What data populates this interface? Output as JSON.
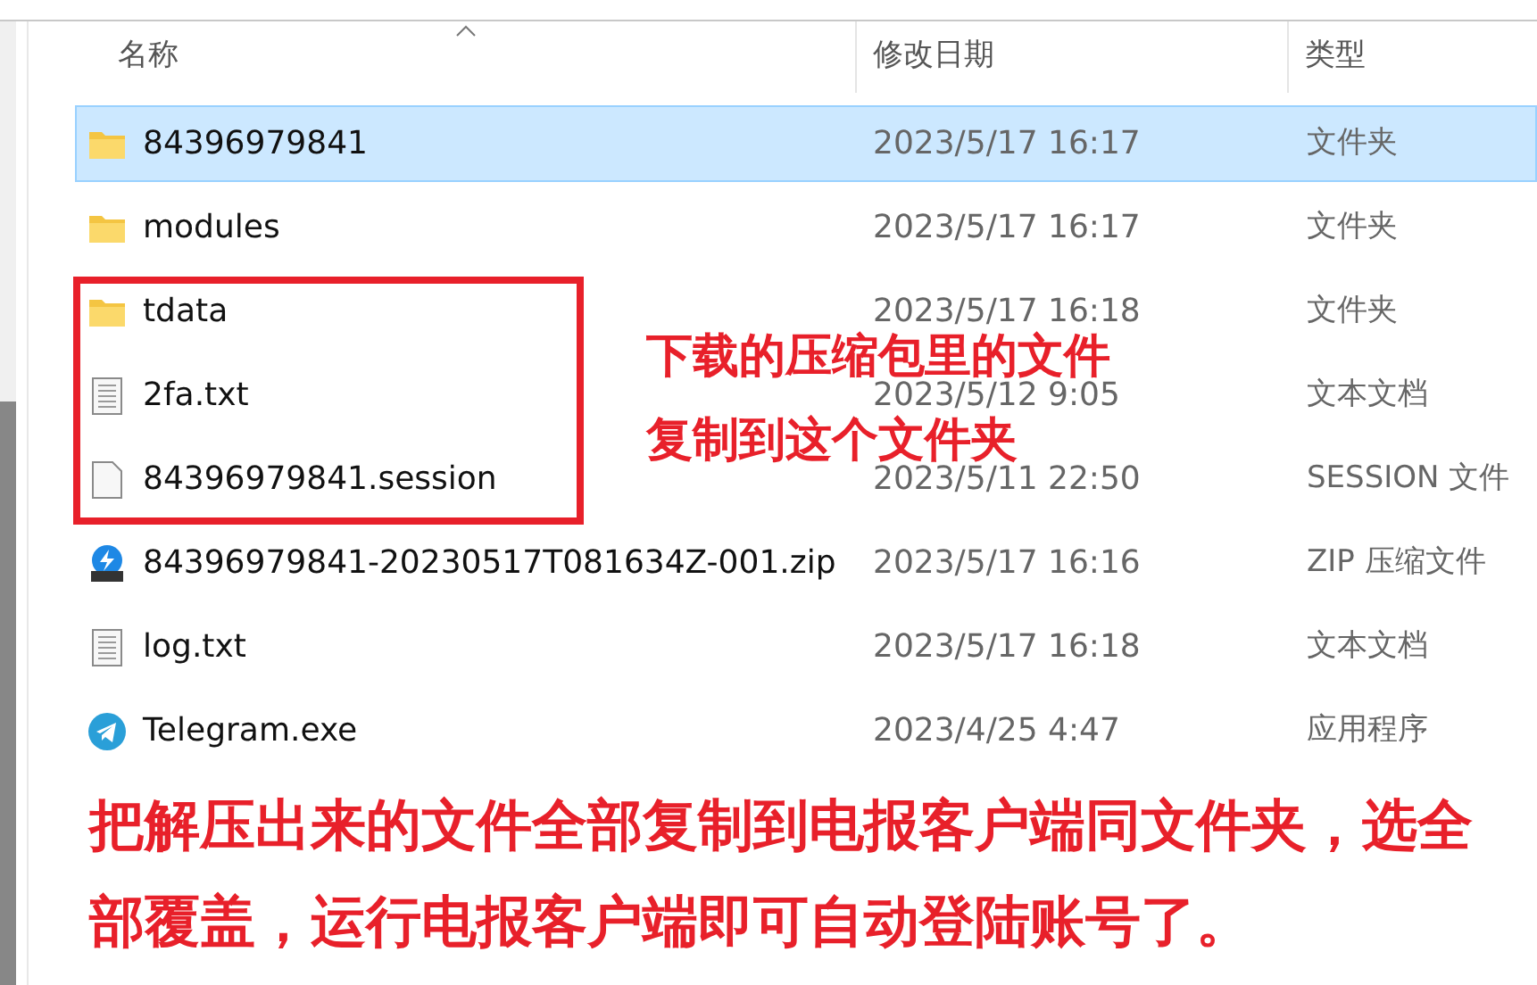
{
  "table": {
    "columns": [
      {
        "label": "名称",
        "sorted": true
      },
      {
        "label": "修改日期",
        "sorted": false
      },
      {
        "label": "类型",
        "sorted": false
      }
    ],
    "rows": [
      {
        "kind": "folder",
        "name": "84396979841",
        "date": "2023/5/17 16:17",
        "type": "文件夹",
        "selected": true
      },
      {
        "kind": "folder",
        "name": "modules",
        "date": "2023/5/17 16:17",
        "type": "文件夹",
        "selected": false
      },
      {
        "kind": "folder",
        "name": "tdata",
        "date": "2023/5/17 16:18",
        "type": "文件夹",
        "selected": false
      },
      {
        "kind": "text",
        "name": "2fa.txt",
        "date": "2023/5/12 9:05",
        "type": "文本文档",
        "selected": false
      },
      {
        "kind": "file",
        "name": "84396979841.session",
        "date": "2023/5/11 22:50",
        "type": "SESSION 文件",
        "selected": false
      },
      {
        "kind": "zip",
        "name": "84396979841-20230517T081634Z-001.zip",
        "date": "2023/5/17 16:16",
        "type": "ZIP 压缩文件",
        "selected": false
      },
      {
        "kind": "text",
        "name": "log.txt",
        "date": "2023/5/17 16:18",
        "type": "文本文档",
        "selected": false
      },
      {
        "kind": "app",
        "name": "Telegram.exe",
        "date": "2023/4/25 4:47",
        "type": "应用程序",
        "selected": false
      }
    ]
  },
  "annotations": {
    "box_note": [
      "下载的压缩包里的文件",
      "复制到这个文件夹"
    ],
    "bottom_note": "把解压出来的文件全部复制到电报客户端同文件夹，选全部覆盖，运行电报客户端即可自动登陆账号了。"
  }
}
